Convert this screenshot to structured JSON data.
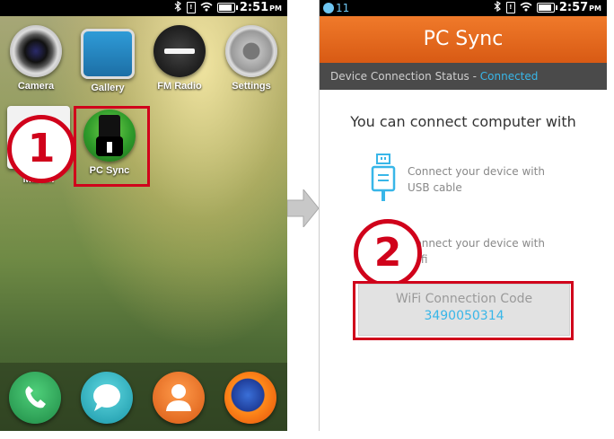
{
  "left_screen": {
    "status": {
      "time": "2:51",
      "ampm": "PM"
    },
    "apps": [
      {
        "label": "Camera",
        "icon": "camera-icon"
      },
      {
        "label": "Gallery",
        "icon": "gallery-icon"
      },
      {
        "label": "FM Radio",
        "icon": "radio-icon"
      },
      {
        "label": "Settings",
        "icon": "gear-icon"
      },
      {
        "label": "Mark...",
        "icon": "marketplace-icon"
      },
      {
        "label": "PC Sync",
        "icon": "usb-icon"
      }
    ],
    "dock": [
      {
        "icon": "phone-icon"
      },
      {
        "icon": "messages-icon"
      },
      {
        "icon": "contacts-icon"
      },
      {
        "icon": "firefox-icon"
      }
    ],
    "step_marker": "1"
  },
  "right_screen": {
    "status": {
      "time": "2:57",
      "ampm": "PM",
      "notification": "11"
    },
    "title": "PC Sync",
    "status_label": "Device Connection Status - ",
    "status_value": "Connected",
    "headline": "You can connect computer with",
    "usb_option": {
      "line1": "Connect your device with",
      "line2": "USB cable"
    },
    "wifi_option": {
      "line1": "Connect your device with",
      "line2": "Wifi"
    },
    "wifi_code_label": "WiFi Connection Code",
    "wifi_code": "3490050314",
    "step_marker": "2"
  },
  "colors": {
    "accent_red": "#d0021b",
    "orange_header": "#e8671c",
    "link_blue": "#38b6e8"
  }
}
